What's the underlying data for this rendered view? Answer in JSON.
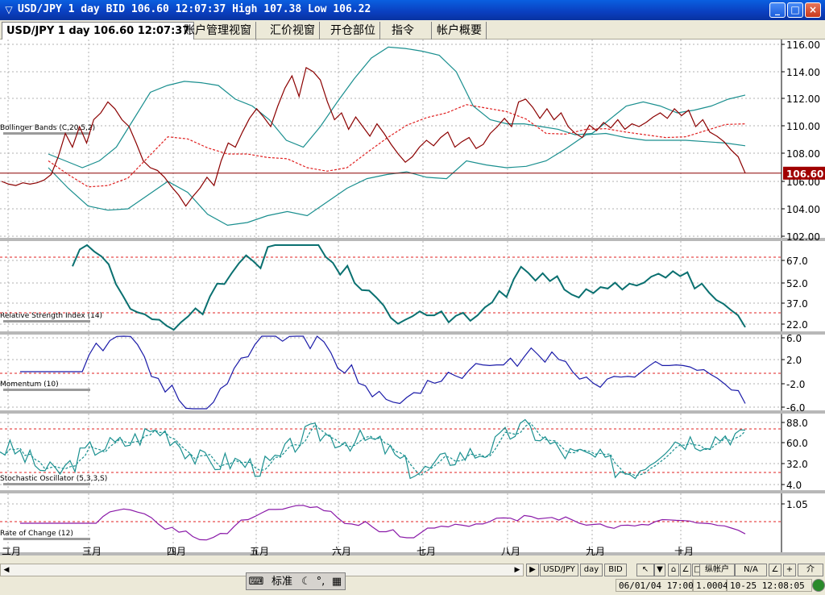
{
  "window": {
    "title": "USD/JPY 1 day BID 106.60 12:07:37 High 107.38 Low 106.22",
    "controls": [
      "_",
      "□",
      "×"
    ]
  },
  "tabs": [
    {
      "label": "USD/JPY 1 day 106.60 12:07:37",
      "active": true
    },
    {
      "label": "账户管理视窗",
      "active": false
    },
    {
      "label": "汇价视窗",
      "active": false
    },
    {
      "label": "开仓部位",
      "active": false
    },
    {
      "label": "指令",
      "active": false
    },
    {
      "label": "帐户概要",
      "active": false
    }
  ],
  "panels": {
    "price": {
      "label": "Bollinger Bands (C,20,5,2)",
      "current_price_label": "106.60",
      "ticks": [
        "116.00",
        "114.00",
        "112.00",
        "110.00",
        "108.00",
        "106.00",
        "104.00",
        "102.00"
      ]
    },
    "rsi": {
      "label": "Relative Strength Index (14)",
      "ticks": [
        "67.0",
        "52.0",
        "37.0",
        "22.0"
      ]
    },
    "momentum": {
      "label": "Momentum (10)",
      "ticks": [
        "6.0",
        "2.0",
        "-2.0",
        "-6.0"
      ]
    },
    "stochastic": {
      "label": "Stochastic Oscillator (5,3,3,S)",
      "ticks": [
        "88.0",
        "60.0",
        "32.0",
        "4.0"
      ]
    },
    "roc": {
      "label": "Rate of Change (12)",
      "ticks": [
        "1.05"
      ]
    }
  },
  "x_axis": [
    "二月",
    "三月",
    "四月",
    "五月",
    "六月",
    "七月",
    "八月",
    "九月",
    "十月"
  ],
  "x_axis_extra": "十月",
  "colors": {
    "price_line": "#8b0000",
    "band": "#1a8f8f",
    "mid_band": "#e02020",
    "rsi": "#0a7070",
    "momentum": "#1a1aa8",
    "stochastic": "#1a9090",
    "roc": "#8a1aa8",
    "reference": "#e02020",
    "grid": "#b0b0b0"
  },
  "chart_data": {
    "type": "line",
    "title": "USD/JPY 1 day BID",
    "price_series": [
      106.0,
      105.8,
      105.7,
      105.9,
      105.8,
      105.9,
      106.1,
      106.5,
      107.8,
      109.5,
      108.5,
      110.0,
      108.8,
      110.5,
      111.0,
      111.8,
      111.3,
      110.5,
      110.0,
      108.8,
      107.5,
      107.0,
      106.8,
      106.3,
      105.6,
      105.0,
      104.2,
      104.9,
      105.5,
      106.3,
      105.7,
      107.5,
      108.8,
      108.5,
      109.6,
      110.6,
      111.3,
      110.7,
      110.0,
      111.5,
      112.8,
      113.7,
      112.2,
      114.3,
      114.0,
      113.4,
      111.8,
      110.5,
      111.0,
      109.8,
      110.7,
      110.0,
      109.3,
      110.2,
      109.5,
      108.7,
      108.0,
      107.4,
      107.8,
      108.5,
      109.0,
      108.6,
      109.2,
      109.6,
      108.5,
      108.9,
      109.2,
      108.4,
      108.7,
      109.5,
      110.0,
      110.6,
      110.0,
      111.8,
      112.0,
      111.4,
      110.6,
      111.3,
      110.5,
      111.0,
      110.0,
      109.5,
      109.2,
      110.1,
      109.7,
      110.3,
      109.9,
      110.5,
      109.8,
      110.2,
      110.0,
      110.3,
      110.7,
      111.0,
      110.6,
      111.3,
      110.8,
      111.2,
      110.0,
      110.5,
      109.6,
      109.3,
      108.9,
      108.3,
      107.8,
      106.6
    ],
    "upper_band": [
      108.0,
      107.5,
      107.0,
      107.5,
      108.5,
      110.5,
      112.5,
      113.0,
      113.3,
      113.2,
      113.0,
      112.0,
      111.5,
      110.5,
      109.0,
      108.5,
      110.0,
      111.8,
      113.5,
      115.0,
      115.8,
      115.7,
      115.5,
      115.2,
      114.0,
      111.5,
      110.5,
      110.2,
      110.2,
      110.0,
      109.8,
      109.4,
      109.5,
      110.5,
      111.5,
      111.8,
      111.5,
      111.0,
      111.2,
      111.5,
      112.0,
      112.3
    ],
    "lower_band": [
      107.0,
      105.5,
      104.2,
      103.9,
      104.0,
      105.0,
      106.0,
      105.2,
      103.6,
      102.8,
      103.0,
      103.5,
      103.8,
      103.5,
      104.5,
      105.5,
      106.2,
      106.5,
      106.7,
      106.3,
      106.2,
      107.5,
      107.2,
      107.0,
      107.1,
      107.5,
      108.4,
      109.4,
      109.5,
      109.2,
      109.0,
      109.0,
      109.0,
      108.9,
      108.8,
      108.6
    ],
    "ylim": [
      102,
      116
    ]
  },
  "statusbar": {
    "buttons": [
      "USD/JPY",
      "day",
      "BID"
    ],
    "extra_buttons": [
      "↖",
      "▼",
      "⌂",
      "∠",
      "□",
      "+",
      "纵帐户"
    ],
    "na_label": "N/A",
    "ime_label": "标准",
    "datetime": "06/01/04 17:00",
    "value": "1.0004",
    "clock": "10-25  12:08:05"
  }
}
